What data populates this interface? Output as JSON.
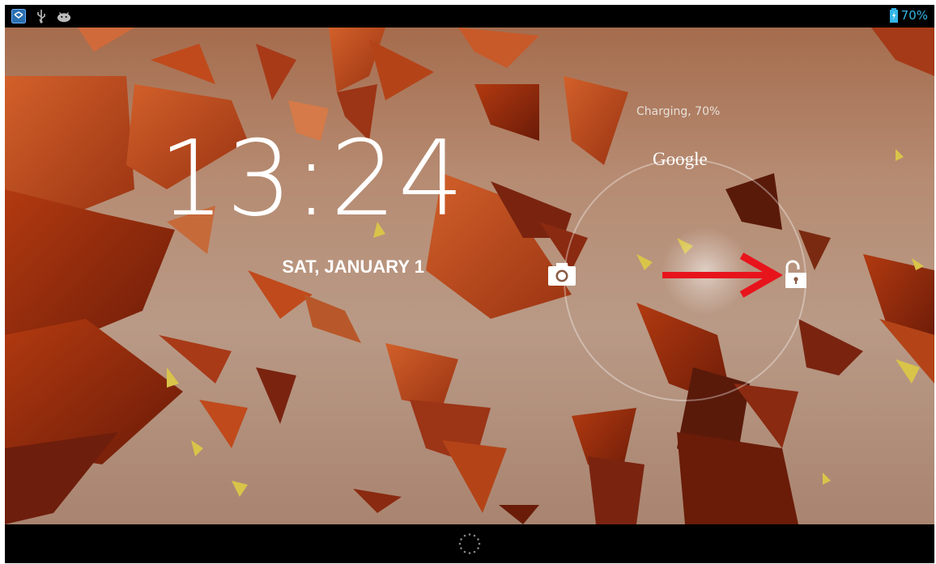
{
  "status_bar": {
    "icons_left": [
      "notification-message-icon",
      "usb-icon",
      "android-debug-icon"
    ],
    "battery_percent": "70%",
    "battery_icon": "battery-charging-icon",
    "accent_color": "#33b5e5"
  },
  "lockscreen": {
    "time": "13:24",
    "date": "SAT, JANUARY 1",
    "charging_status": "Charging, 70%",
    "google_label": "Google",
    "left_target_icon": "camera-icon",
    "right_target_icon": "unlock-icon",
    "annotation_color": "#e8141c"
  },
  "nav_bar": {
    "center_icon": "loading-spinner-icon"
  }
}
